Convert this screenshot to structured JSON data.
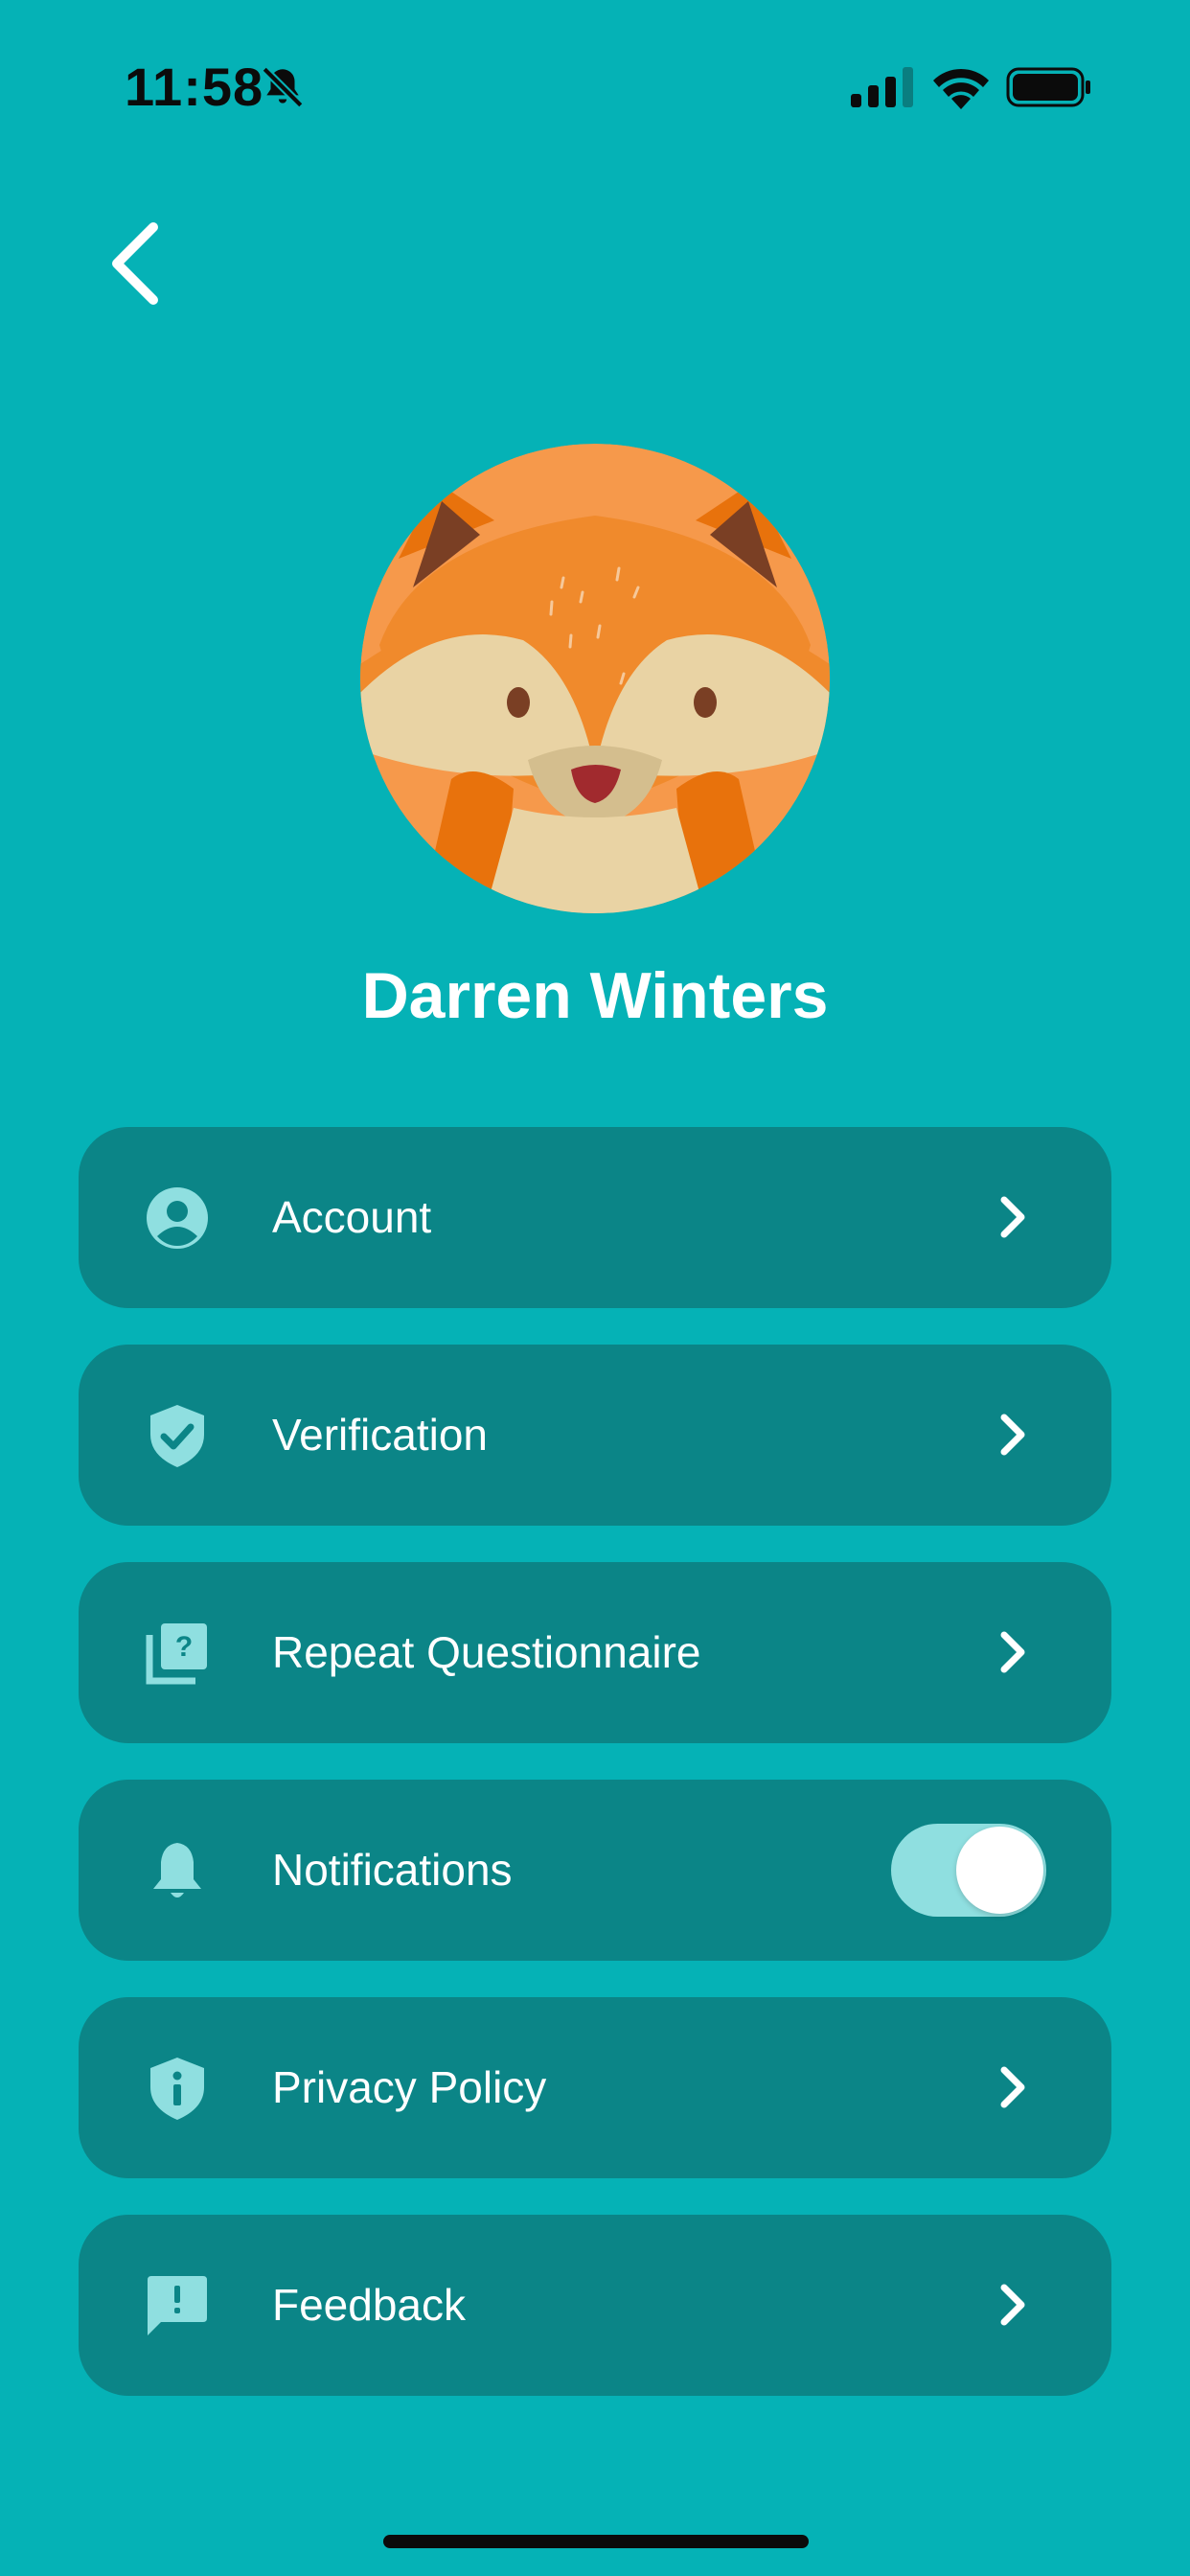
{
  "status_bar": {
    "time": "11:58",
    "icons": [
      "bell-slash-icon",
      "signal-icon",
      "wifi-icon",
      "battery-icon"
    ]
  },
  "header": {
    "back_icon": "chevron-left-icon"
  },
  "profile": {
    "avatar": "fox-avatar",
    "name": "Darren Winters"
  },
  "menu": {
    "items": [
      {
        "label": "Account",
        "icon": "user-circle-icon",
        "trailing": "chevron"
      },
      {
        "label": "Verification",
        "icon": "shield-check-icon",
        "trailing": "chevron"
      },
      {
        "label": "Repeat Questionnaire",
        "icon": "question-library-icon",
        "trailing": "chevron"
      },
      {
        "label": "Notifications",
        "icon": "bell-icon",
        "trailing": "toggle",
        "toggle_on": true
      },
      {
        "label": "Privacy Policy",
        "icon": "shield-info-icon",
        "trailing": "chevron"
      },
      {
        "label": "Feedback",
        "icon": "feedback-icon",
        "trailing": "chevron"
      }
    ]
  },
  "colors": {
    "background": "#05B2B6",
    "card": "#0B8587",
    "icon": "#8FDFE0",
    "toggle_track": "#8FDFE0",
    "text": "#FFFFFF"
  }
}
